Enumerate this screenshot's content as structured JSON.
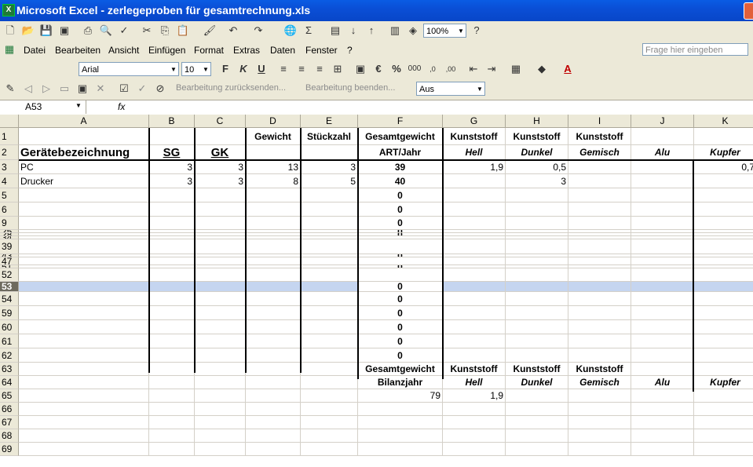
{
  "window": {
    "title": "Microsoft Excel - zerlegeproben für gesamtrechnung.xls",
    "app_icon_label": "X"
  },
  "toolbar_standard": {
    "zoom": "100%"
  },
  "menu": {
    "items": [
      "Datei",
      "Bearbeiten",
      "Ansicht",
      "Einfügen",
      "Format",
      "Extras",
      "Daten",
      "Fenster",
      "?"
    ],
    "help_placeholder": "Frage hier eingeben"
  },
  "format_bar": {
    "font": "Arial",
    "size": "10",
    "bold": "F",
    "italic": "K",
    "underline": "U",
    "euro": "€",
    "percent": "%",
    "thousands": "000",
    "font_color_letter": "A"
  },
  "review_bar": {
    "reply": "Bearbeitung zurücksenden...",
    "end": "Bearbeitung beenden...",
    "mode": "Aus"
  },
  "formula_bar": {
    "name_box": "A53",
    "fx": "fx",
    "content": ""
  },
  "columns": [
    "A",
    "B",
    "C",
    "D",
    "E",
    "F",
    "G",
    "H",
    "I",
    "J",
    "K"
  ],
  "rows": [
    {
      "n": "1",
      "cells": {
        "D": "Gewicht",
        "E": "Stückzahl",
        "F": "Gesamtgewicht",
        "G": "Kunststoff",
        "H": "Kunststoff",
        "I": "Kunststoff"
      }
    },
    {
      "n": "2",
      "cells": {
        "A": "Gerätebezeichnung",
        "B": "SG",
        "C": "GK",
        "F": "ART/Jahr",
        "G": "Hell",
        "H": "Dunkel",
        "I": "Gemisch",
        "J": "Alu",
        "K": "Kupfer"
      }
    },
    {
      "n": "3",
      "cells": {
        "A": "PC",
        "B": "3",
        "C": "3",
        "D": "13",
        "E": "3",
        "F": "39",
        "G": "1,9",
        "H": "0,5",
        "K": "0,7"
      }
    },
    {
      "n": "4",
      "cells": {
        "A": "Drucker",
        "B": "3",
        "C": "3",
        "D": "8",
        "E": "5",
        "F": "40",
        "H": "3"
      }
    },
    {
      "n": "5",
      "cells": {
        "F": "0"
      }
    },
    {
      "n": "6",
      "cells": {
        "F": "0"
      }
    },
    {
      "n": "9",
      "cells": {
        "F": "0"
      }
    },
    {
      "n": "25",
      "cells": {
        "F": "0"
      }
    },
    {
      "n": "28",
      "cells": {
        "F": "0"
      }
    },
    {
      "n": "34",
      "cells": {}
    },
    {
      "n": "39",
      "cells": {}
    },
    {
      "n": "43",
      "cells": {
        "F": "0"
      }
    },
    {
      "n": "47",
      "cells": {}
    },
    {
      "n": "51",
      "cells": {
        "F": "0"
      }
    },
    {
      "n": "52",
      "cells": {}
    },
    {
      "n": "53",
      "cells": {
        "F": "0"
      }
    },
    {
      "n": "54",
      "cells": {
        "F": "0"
      }
    },
    {
      "n": "59",
      "cells": {
        "F": "0"
      }
    },
    {
      "n": "60",
      "cells": {
        "F": "0"
      }
    },
    {
      "n": "61",
      "cells": {
        "F": "0"
      }
    },
    {
      "n": "62",
      "cells": {
        "F": "0"
      }
    },
    {
      "n": "63",
      "cells": {
        "F": "Gesamtgewicht",
        "G": "Kunststoff",
        "H": "Kunststoff",
        "I": "Kunststoff"
      }
    },
    {
      "n": "64",
      "cells": {
        "F": "Bilanzjahr",
        "G": "Hell",
        "H": "Dunkel",
        "I": "Gemisch",
        "J": "Alu",
        "K": "Kupfer"
      }
    },
    {
      "n": "65",
      "cells": {
        "F": "79",
        "G": "1,9"
      }
    },
    {
      "n": "66",
      "cells": {}
    },
    {
      "n": "67",
      "cells": {}
    },
    {
      "n": "68",
      "cells": {}
    },
    {
      "n": "69",
      "cells": {}
    }
  ]
}
